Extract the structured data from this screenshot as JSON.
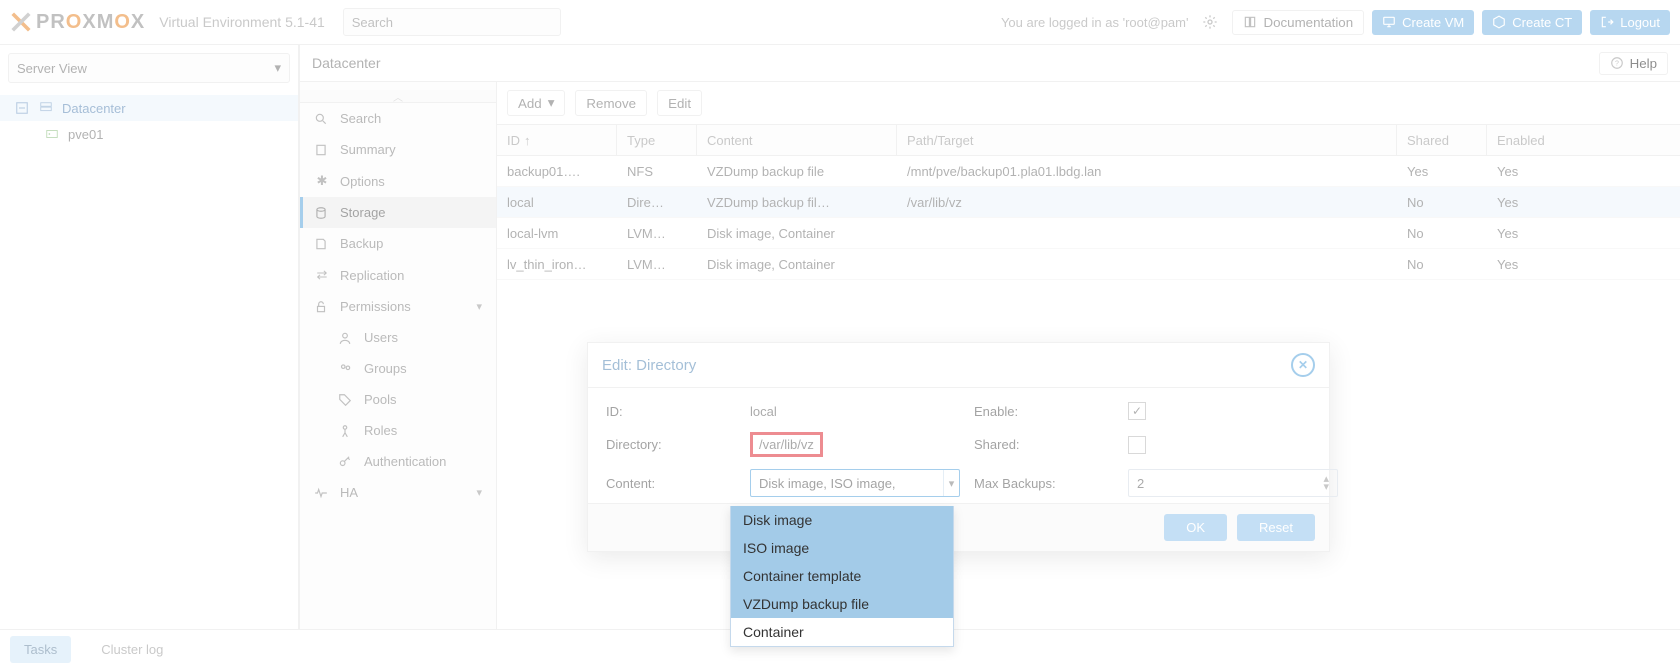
{
  "header": {
    "product": "PROXMOX",
    "product_o_index": 2,
    "env": "Virtual Environment 5.1-41",
    "search_placeholder": "Search",
    "logged_in_text": "You are logged in as 'root@pam'",
    "documentation": "Documentation",
    "create_vm": "Create VM",
    "create_ct": "Create CT",
    "logout": "Logout"
  },
  "view_selector": "Server View",
  "tree": {
    "root": "Datacenter",
    "nodes": [
      "pve01"
    ]
  },
  "crumb": "Datacenter",
  "help": "Help",
  "sidemenu": {
    "search": "Search",
    "summary": "Summary",
    "options": "Options",
    "storage": "Storage",
    "backup": "Backup",
    "replication": "Replication",
    "permissions": "Permissions",
    "users": "Users",
    "groups": "Groups",
    "pools": "Pools",
    "roles": "Roles",
    "authentication": "Authentication",
    "ha": "HA"
  },
  "toolbar": {
    "add": "Add",
    "remove": "Remove",
    "edit": "Edit"
  },
  "columns": {
    "id": "ID",
    "type": "Type",
    "content": "Content",
    "path": "Path/Target",
    "shared": "Shared",
    "enabled": "Enabled"
  },
  "rows": [
    {
      "id": "backup01….",
      "type": "NFS",
      "content": "VZDump backup file",
      "path": "/mnt/pve/backup01.pla01.lbdg.lan",
      "shared": "Yes",
      "enabled": "Yes",
      "sel": false
    },
    {
      "id": "local",
      "type": "Dire…",
      "content": "VZDump backup fil…",
      "path": "/var/lib/vz",
      "shared": "No",
      "enabled": "Yes",
      "sel": true
    },
    {
      "id": "local-lvm",
      "type": "LVM…",
      "content": "Disk image, Container",
      "path": "",
      "shared": "No",
      "enabled": "Yes",
      "sel": false
    },
    {
      "id": "lv_thin_iron…",
      "type": "LVM…",
      "content": "Disk image, Container",
      "path": "",
      "shared": "No",
      "enabled": "Yes",
      "sel": false
    }
  ],
  "dialog": {
    "title": "Edit: Directory",
    "id_label": "ID:",
    "id_value": "local",
    "dir_label": "Directory:",
    "dir_value": "/var/lib/vz",
    "content_label": "Content:",
    "content_value": "Disk image, ISO image,",
    "enable_label": "Enable:",
    "enable_checked": true,
    "shared_label": "Shared:",
    "shared_checked": false,
    "maxbackups_label": "Max Backups:",
    "maxbackups_value": "2",
    "ok": "OK",
    "reset": "Reset"
  },
  "dropdown": [
    {
      "label": "Disk image",
      "sel": true
    },
    {
      "label": "ISO image",
      "sel": true
    },
    {
      "label": "Container template",
      "sel": true
    },
    {
      "label": "VZDump backup file",
      "sel": true
    },
    {
      "label": "Container",
      "sel": false
    }
  ],
  "bottom": {
    "tasks": "Tasks",
    "cluster_log": "Cluster log"
  }
}
